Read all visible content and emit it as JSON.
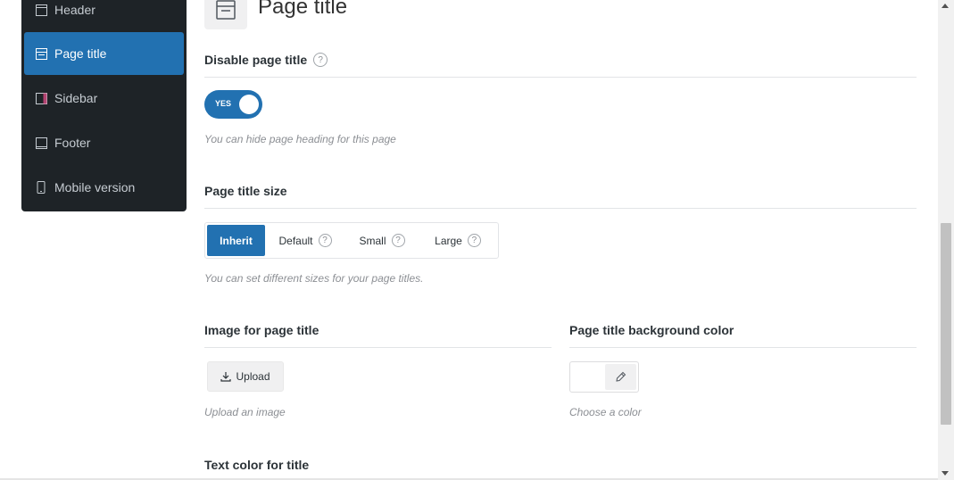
{
  "sidebar": {
    "items": [
      {
        "label": "Header",
        "icon": "header-layout-icon"
      },
      {
        "label": "Page title",
        "icon": "page-title-layout-icon",
        "active": true
      },
      {
        "label": "Sidebar",
        "icon": "sidebar-layout-icon"
      },
      {
        "label": "Footer",
        "icon": "footer-layout-icon"
      },
      {
        "label": "Mobile version",
        "icon": "mobile-icon"
      }
    ]
  },
  "main": {
    "title": "Page title",
    "title_icon": "page-title-layout-icon",
    "disable_title": {
      "label": "Disable page title",
      "help": "?",
      "toggle_label": "YES",
      "toggle_on": true,
      "description": "You can hide page heading for this page"
    },
    "title_size": {
      "label": "Page title size",
      "options": [
        {
          "label": "Inherit",
          "active": true
        },
        {
          "label": "Default",
          "help": "?"
        },
        {
          "label": "Small",
          "help": "?"
        },
        {
          "label": "Large",
          "help": "?"
        }
      ],
      "description": "You can set different sizes for your page titles."
    },
    "image": {
      "label": "Image for page title",
      "button_label": "Upload",
      "description": "Upload an image"
    },
    "bg_color": {
      "label": "Page title background color",
      "description": "Choose a color"
    },
    "text_color": {
      "label": "Text color for title"
    }
  },
  "colors": {
    "accent": "#2271b1",
    "sidebar_bg": "#1e2327"
  }
}
